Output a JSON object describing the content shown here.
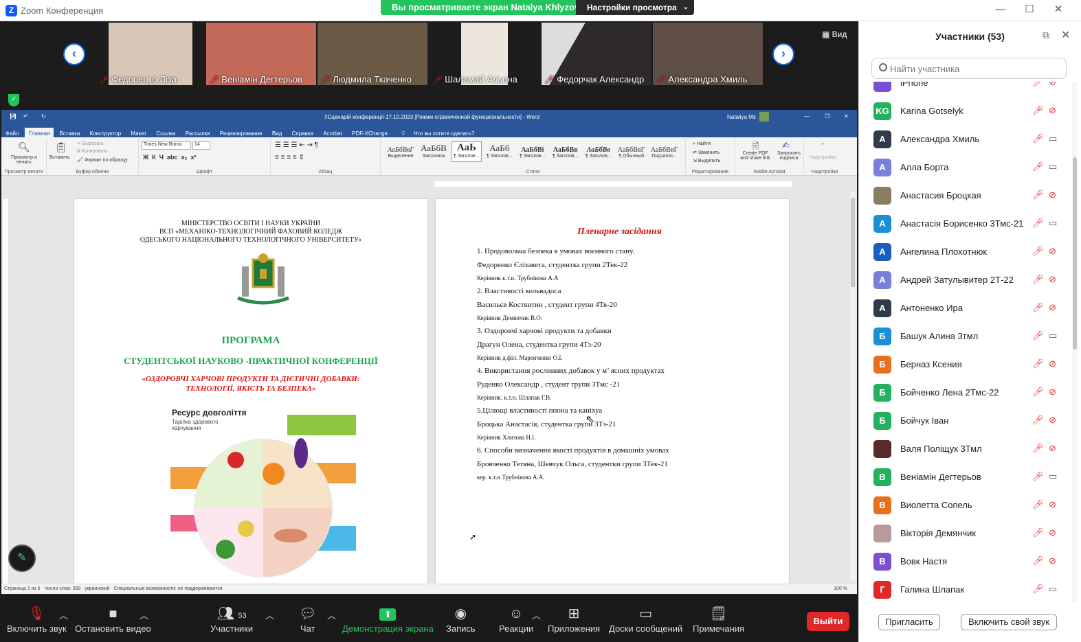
{
  "window": {
    "title": "Zoom Конференция"
  },
  "share_banner": {
    "text": "Вы просматриваете экран Natalya Khlyzova",
    "view_options": "Настройки просмотра"
  },
  "video_strip": {
    "view_label": "Вид",
    "tiles": [
      {
        "name": "Федоренко Ліза",
        "bg": "#d8c6b6"
      },
      {
        "name": "Веніамін Дегтерьов",
        "bg": "#c46a5a"
      },
      {
        "name": "Людмила Ткаченко",
        "bg": "#6c5a46"
      },
      {
        "name": "Шаламай Альона",
        "bg": "#ece6de"
      },
      {
        "name": "Федорчак Александр",
        "bg": "#2e2a2c"
      },
      {
        "name": "Александра Хмиль",
        "bg": "#5e4e46"
      }
    ]
  },
  "word": {
    "title": "!!Сценарій конференції-17.10.2023 [Режим ограниченной функциональности] - Word",
    "user": "Nataliya Ms",
    "tabs": [
      "Файл",
      "Главная",
      "Вставка",
      "Конструктор",
      "Макет",
      "Ссылки",
      "Рассылки",
      "Рецензирование",
      "Вид",
      "Справка",
      "Acrobat",
      "PDF-XChange",
      "Что вы хотите сделать?"
    ],
    "ribbon": {
      "print_preview": "Просмотр и печать",
      "paste": "Вставить",
      "cut": "Вырезать",
      "copy": "Копировать",
      "format_painter": "Формат по образцу",
      "font_name": "Times New Roma",
      "font_size": "14",
      "find": "Найти",
      "replace": "Заменить",
      "select": "Выделить",
      "create_pdf": "Create PDF and share link",
      "request_sign": "Запросить подписи",
      "addins": "Надстройки",
      "groups": [
        "Просмотр печати",
        "Буфер обмена",
        "Шрифт",
        "Абзац",
        "Стили",
        "Редактирование",
        "Adobe Acrobat",
        "Надстройки"
      ],
      "styles": [
        {
          "sample": "АаБбВвГ",
          "name": "Выделение"
        },
        {
          "sample": "АаБбВ",
          "name": "Заголовок"
        },
        {
          "sample": "АаЬ",
          "name": "¶ Заголов..."
        },
        {
          "sample": "АаБб",
          "name": "¶ Заголов..."
        },
        {
          "sample": "АаБбВі",
          "name": "¶ Заголов..."
        },
        {
          "sample": "АаБбВв",
          "name": "¶ Заголов..."
        },
        {
          "sample": "АаБбВв",
          "name": "¶ Заголов..."
        },
        {
          "sample": "АаБбВвГ",
          "name": "¶ Обычный"
        },
        {
          "sample": "АаБбВвГ",
          "name": "Подзагол..."
        }
      ]
    },
    "page1": {
      "ministry": "МІНІСТЕРСТВО ОСВІТИ І НАУКИ УКРАЇНИ",
      "college": "ВСП «МЕХАНІКО-ТЕХНОЛОГІЧНИЙ ФАХОВИЙ КОЛЕДЖ",
      "university": "ОДЕСЬКОГО НАЦІОНАЛЬНОГО  ТЕХНОЛОГІЧНОГО УНІВЕРСИТЕТУ»",
      "program": "ПРОГРАМА",
      "conference": "СТУДЕНТСЬКОЇ НАУКОВО -ПРАКТИЧНОЇ КОНФЕРЕНЦІЇ",
      "topic1": "«ОЗДОРОВЧІ ХАРЧОВІ ПРОДУКТИ ТА ДІЄТИЧНІ ДОБАВКИ:",
      "topic2": "ТЕХНОЛОГІЇ, ЯКІСТЬ ТА БЕЗПЕКА»",
      "info_title": "Ресурс довголіття",
      "info_subtitle": "Тарілка здорового харчування"
    },
    "page2": {
      "title": "Пленарне засідання",
      "lines": [
        {
          "text": "1. Продовольча безпека в умовах воєнного стану.",
          "small": false
        },
        {
          "text": "Федоренко Єлізавета, студентка групи 2Тек-22",
          "small": false
        },
        {
          "text": "Керівник к.т.н. Трубнікова А.А",
          "small": true
        },
        {
          "text": "2. Властивості кольвадоса",
          "small": false
        },
        {
          "text": "Васильєв Костянтин , студент групи 4Тв-20",
          "small": false
        },
        {
          "text": "Керівник Демянчик В.О.",
          "small": true
        },
        {
          "text": "3. Оздоровчі харчові продукти та добавки",
          "small": false
        },
        {
          "text": "Драгун Олена, студентка групи 4Тз-20",
          "small": false
        },
        {
          "text": "Керівник  д.філ. Маренченко О.І.",
          "small": true
        },
        {
          "text": "4. Використання рослинних добавок у м’ ясних продуктах",
          "small": false
        },
        {
          "text": "  Руденко Олександр , студент групи 3Тмс -21",
          "small": false
        },
        {
          "text": "Керівник. к.т.н. Шлапак Г.В.",
          "small": true
        },
        {
          "text": "5.Цілющі властивості ппона та каніхуа",
          "small": false
        },
        {
          "text": "Броцька Анастасія, студентка групи 3Тз-21",
          "small": false
        },
        {
          "text": "Керівник Хлизова Н.І.",
          "small": true
        },
        {
          "text": "6. Способи визначення якості продуктів в домашніх умовах",
          "small": false
        },
        {
          "text": "Бровченко Тетяна, Шевчук Ольга,  студентки групи 3Тек-21",
          "small": false
        },
        {
          "text": "кер. к.т.н Трубнікова А.А.",
          "small": true
        }
      ]
    },
    "status": {
      "page": "Страница 2 из 6",
      "words": "Число слов: 359",
      "language": "украинский",
      "accessibility": "Специальные возможности: не поддерживаются",
      "zoom": "100 %"
    }
  },
  "toolbar": {
    "unmute": "Включить звук",
    "stop_video": "Остановить видео",
    "participants": "Участники",
    "participants_count": "53",
    "chat": "Чат",
    "share": "Демонстрация экрана",
    "record": "Запись",
    "reactions": "Реакции",
    "apps": "Приложения",
    "whiteboards": "Доски сообщений",
    "notes": "Примечания",
    "leave": "Выйти"
  },
  "participants_panel": {
    "title": "Участники (53)",
    "search_placeholder": "Найти участника",
    "invite": "Пригласить",
    "unmute_me": "Включить свой звук",
    "participants": [
      {
        "initial": "",
        "name": "iPhone",
        "color": "#7b4fd1",
        "video": "off"
      },
      {
        "initial": "KG",
        "name": "Karina Gotselyk",
        "color": "#23b15f",
        "video": "off"
      },
      {
        "initial": "А",
        "name": "Александра Хмиль",
        "color": "#2f3a4a",
        "video": "on"
      },
      {
        "initial": "А",
        "name": "Алла Борта",
        "color": "#7b7fdc",
        "video": "on"
      },
      {
        "initial": "",
        "name": "Анастасия Броцкая",
        "color": "#8a7b62",
        "video": "off"
      },
      {
        "initial": "А",
        "name": "Анастасія Борисенко 3Тмс-21",
        "color": "#1a8fd6",
        "video": "on"
      },
      {
        "initial": "А",
        "name": "Ангелина  Плохотнюк",
        "color": "#1a5fbf",
        "video": "off"
      },
      {
        "initial": "А",
        "name": "Андрей Затулывитер 2Т-22",
        "color": "#7b7fdc",
        "video": "off"
      },
      {
        "initial": "А",
        "name": "Антоненко Ира",
        "color": "#2f3a4a",
        "video": "off"
      },
      {
        "initial": "Б",
        "name": "Башук Алина 3тмл",
        "color": "#1a8fd6",
        "video": "on"
      },
      {
        "initial": "Б",
        "name": "Берназ Ксения",
        "color": "#e8701a",
        "video": "off"
      },
      {
        "initial": "Б",
        "name": "Бойченко Лена 2Тмс-22",
        "color": "#23b15f",
        "video": "off"
      },
      {
        "initial": "Б",
        "name": "Бойчук Іван",
        "color": "#23b15f",
        "video": "off"
      },
      {
        "initial": "",
        "name": "Валя Поліщук 3Тмл",
        "color": "#5a2a2a",
        "video": "off"
      },
      {
        "initial": "В",
        "name": "Веніамін Дегтерьов",
        "color": "#23b15f",
        "video": "on"
      },
      {
        "initial": "В",
        "name": "Виолетта  Сопель",
        "color": "#e8701a",
        "video": "off"
      },
      {
        "initial": "",
        "name": "Вікторія Демянчик",
        "color": "#b89a9a",
        "video": "off"
      },
      {
        "initial": "В",
        "name": "Вовк Настя",
        "color": "#7b4fd1",
        "video": "off"
      },
      {
        "initial": "Г",
        "name": "Галина Шлапак",
        "color": "#e02828",
        "video": "on"
      }
    ]
  }
}
